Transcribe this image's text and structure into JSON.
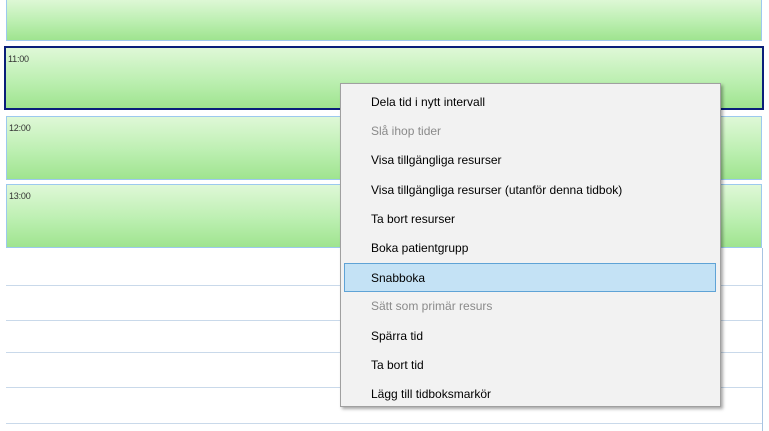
{
  "schedule": {
    "slots": [
      {
        "time": ""
      },
      {
        "time": "11:00",
        "selected": true
      },
      {
        "time": "12:00"
      },
      {
        "time": "13:00"
      }
    ],
    "colors": {
      "slot_fill_top": "#dff8d7",
      "slot_fill_bottom": "#9fe48f",
      "slot_border": "#9cc9ee",
      "selected_border": "#0a1f7a",
      "grid_line": "#c9d9ea"
    }
  },
  "context_menu": {
    "items": [
      {
        "label": "Dela tid i nytt intervall",
        "enabled": true
      },
      {
        "label": "Slå ihop tider",
        "enabled": false
      },
      {
        "label": "Visa tillgängliga resurser",
        "enabled": true
      },
      {
        "label": "Visa tillgängliga resurser (utanför denna tidbok)",
        "enabled": true
      },
      {
        "label": "Ta bort resurser",
        "enabled": true
      },
      {
        "label": "Boka patientgrupp",
        "enabled": true
      },
      {
        "label": "Snabboka",
        "enabled": true,
        "highlighted": true
      },
      {
        "label": "Sätt som primär resurs",
        "enabled": false
      },
      {
        "label": "Spärra tid",
        "enabled": true
      },
      {
        "label": "Ta bort tid",
        "enabled": true
      },
      {
        "label": "Lägg till tidboksmarkör",
        "enabled": true
      }
    ],
    "colors": {
      "background": "#f2f2f2",
      "highlight_fill": "#c4e2f5",
      "highlight_border": "#5fa3d6",
      "disabled_text": "#8a8a8a"
    }
  }
}
